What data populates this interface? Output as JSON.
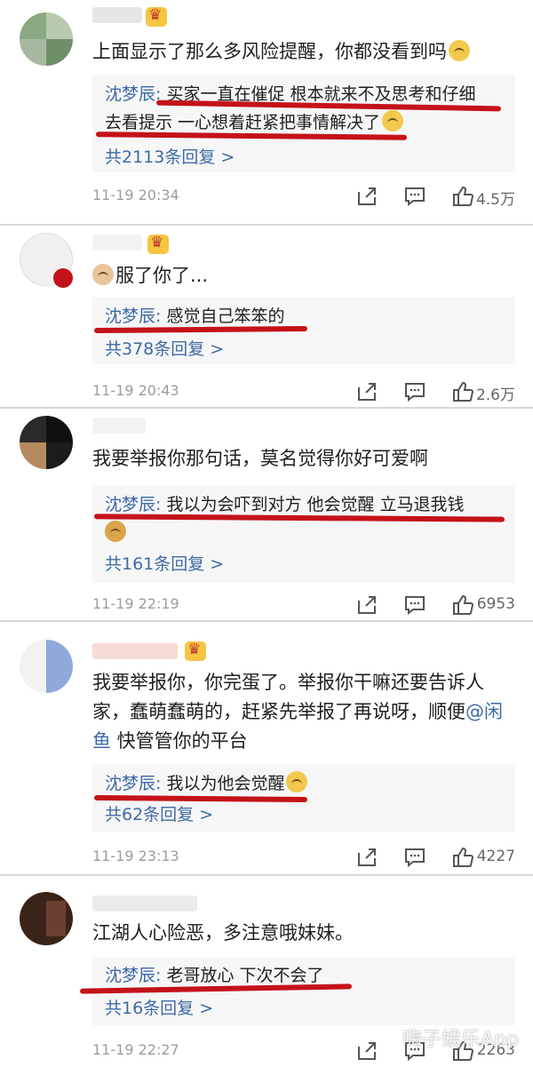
{
  "colors": {
    "link": "#3e6aa6",
    "underline": "#c4121a",
    "reply_bg": "#f6f6f6",
    "meta": "#9c9c9c"
  },
  "comments": [
    {
      "text": "上面显示了那么多风险提醒，你都没看到吗",
      "reply_author": "沈梦辰:",
      "reply_line1": "买家一直在催促 根本就来不及思考和仔细",
      "reply_line2": "去看提示 一心想着赶紧把事情解决了",
      "more": "共2113条回复 >",
      "time": "11-19 20:34",
      "likes": "4.5万"
    },
    {
      "text": "服了你了...",
      "reply_author": "沈梦辰:",
      "reply_line1": "感觉自己笨笨的",
      "more": "共378条回复 >",
      "time": "11-19 20:43",
      "likes": "2.6万"
    },
    {
      "text": "我要举报你那句话，莫名觉得你好可爱啊",
      "reply_author": "沈梦辰:",
      "reply_line1": "我以为会吓到对方 他会觉醒 立马退我钱",
      "more": "共161条回复 >",
      "time": "11-19 22:19",
      "likes": "6953"
    },
    {
      "text_line1": "我要举报你，你完蛋了。举报你干嘛还要告诉人",
      "text_line2": "家，蠢萌蠢萌的，赶紧先举报了再说呀，顺便",
      "mention_a": "@闲",
      "mention_b": "鱼",
      "text_line3": " 快管管你的平台",
      "reply_author": "沈梦辰:",
      "reply_line1": "我以为他会觉醒",
      "more": "共62条回复 >",
      "time": "11-19 23:13",
      "likes": "4227"
    },
    {
      "text": "江湖人心险恶，多注意哦妹妹。",
      "reply_author": "沈梦辰:",
      "reply_line1": "老哥放心 下次不会了",
      "more": "共16条回复 >",
      "time": "11-19 22:27",
      "likes": "2263"
    }
  ],
  "icons": {
    "share": "share-icon",
    "comment": "comment-icon",
    "like": "like-icon"
  },
  "watermark": "嗨子娱乐App"
}
